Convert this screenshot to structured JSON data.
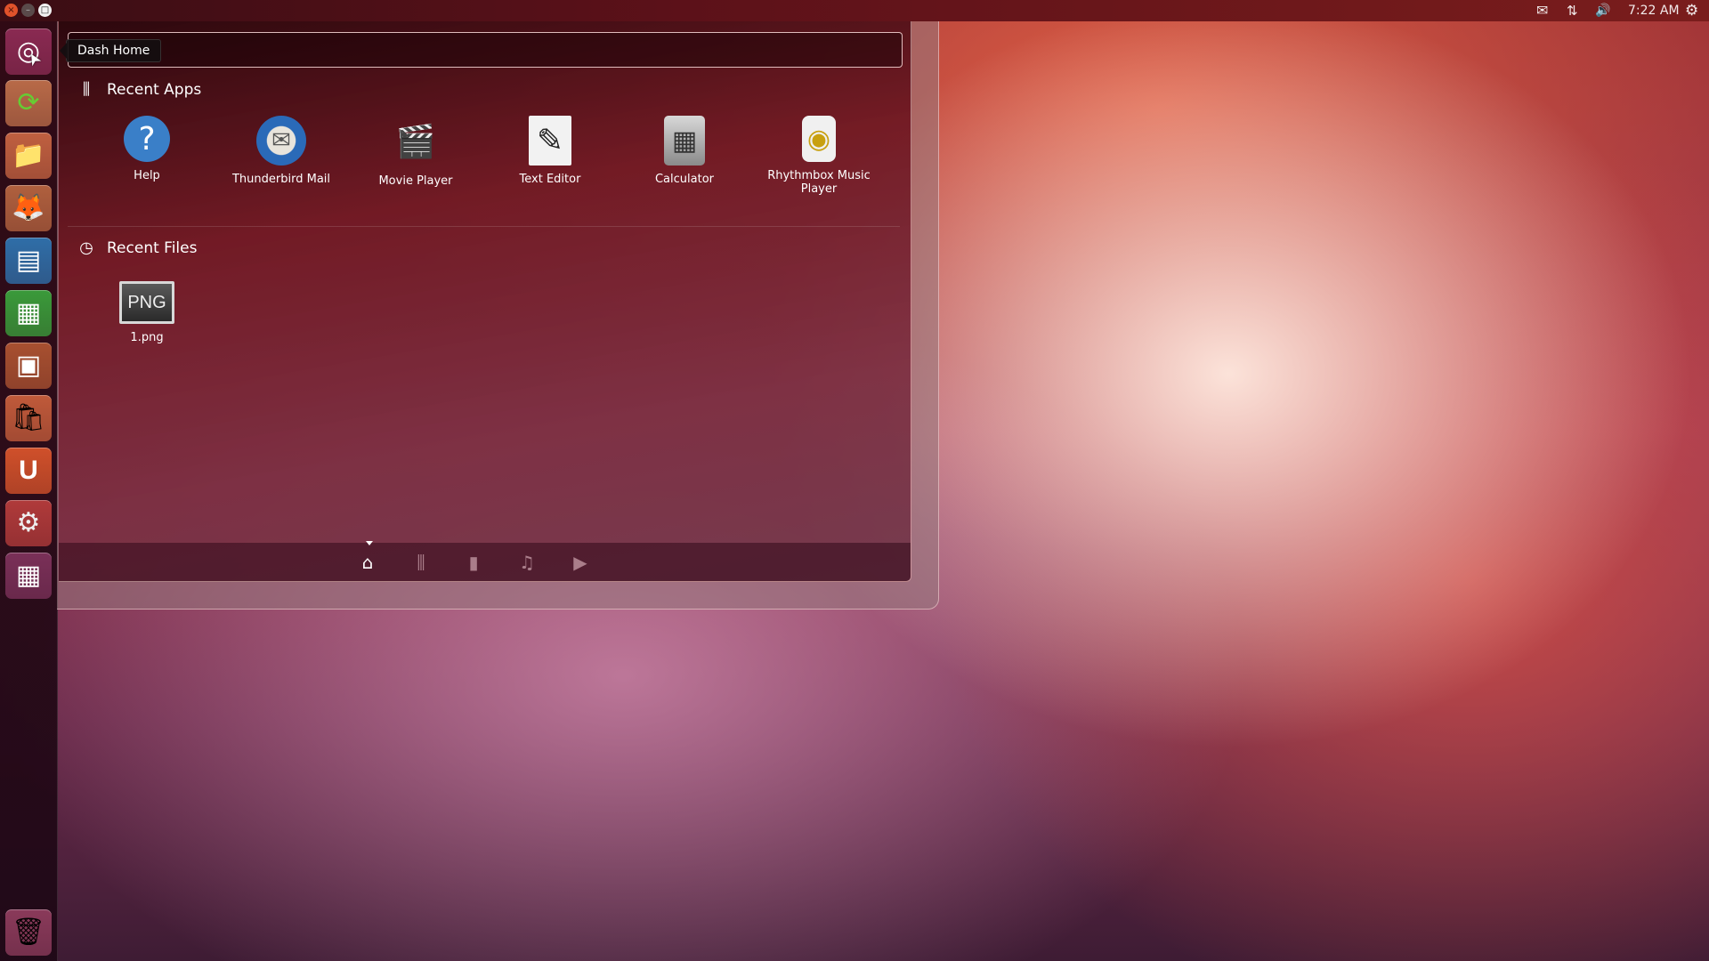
{
  "window_controls": {
    "close": "×",
    "minimize": "–",
    "maximize": "□"
  },
  "top_panel": {
    "indicators": {
      "mail_icon": "✉",
      "network_icon": "⇅",
      "volume_icon": "🔊",
      "clock": "7:22 AM",
      "session_icon": "⚙"
    }
  },
  "launcher": {
    "items": [
      {
        "name": "dash-home",
        "icon": "◎",
        "bg": "#8a2a52"
      },
      {
        "name": "software-updater",
        "icon": "⟳",
        "bg": "#b86a48"
      },
      {
        "name": "files",
        "icon": "📁",
        "bg": "#c06040"
      },
      {
        "name": "firefox",
        "icon": "🦊",
        "bg": "#b0603e"
      },
      {
        "name": "libreoffice-writer",
        "icon": "▤",
        "bg": "#2f6ea8"
      },
      {
        "name": "libreoffice-calc",
        "icon": "▦",
        "bg": "#3a9a3a"
      },
      {
        "name": "libreoffice-impress",
        "icon": "▣",
        "bg": "#a85030"
      },
      {
        "name": "software-center",
        "icon": "🛍",
        "bg": "#c05a3a"
      },
      {
        "name": "ubuntu-one",
        "icon": "U",
        "bg": "#d0502a"
      },
      {
        "name": "system-settings",
        "icon": "⚙",
        "bg": "#b03a3a"
      },
      {
        "name": "workspace-switcher",
        "icon": "▦",
        "bg": "#7a3058"
      }
    ],
    "trash": {
      "icon": "🗑",
      "bg": "#8a3a5a"
    }
  },
  "tooltip": "Dash Home",
  "dash": {
    "search": {
      "value": "",
      "placeholder": ""
    },
    "recent_apps": {
      "title": "Recent Apps",
      "icon": "applications-icon",
      "items": [
        {
          "label": "Help",
          "icon": "?",
          "color": "#3a7fc8"
        },
        {
          "label": "Thunderbird Mail",
          "icon": "✉",
          "color": "#2a6ab8"
        },
        {
          "label": "Movie Player",
          "icon": "🎬",
          "color": "#444444"
        },
        {
          "label": "Text Editor",
          "icon": "✎",
          "color": "#e8e8e8"
        },
        {
          "label": "Calculator",
          "icon": "▦",
          "color": "#9a9a9a"
        },
        {
          "label": "Rhythmbox Music Player",
          "icon": "◉",
          "color": "#f0f0f0"
        }
      ]
    },
    "recent_files": {
      "title": "Recent Files",
      "icon": "clock-icon",
      "items": [
        {
          "label": "1.png",
          "icon": "PNG"
        }
      ]
    },
    "lenses": [
      {
        "name": "home",
        "icon": "⌂",
        "active": true
      },
      {
        "name": "applications",
        "icon": "⫼",
        "active": false
      },
      {
        "name": "files",
        "icon": "▮",
        "active": false
      },
      {
        "name": "music",
        "icon": "♫",
        "active": false
      },
      {
        "name": "video",
        "icon": "▶",
        "active": false
      }
    ]
  }
}
